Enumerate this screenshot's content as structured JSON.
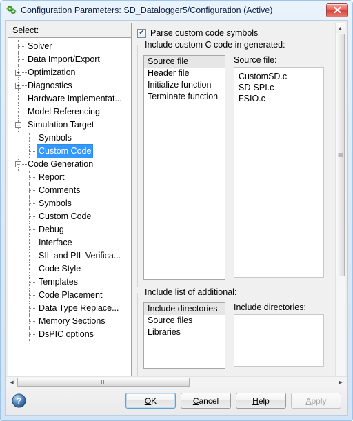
{
  "window": {
    "title": "Configuration Parameters: SD_Datalogger5/Configuration (Active)",
    "icon": "simulink-gear-icon",
    "close_label": "✕",
    "accent_blue": "#3399ff",
    "frame_color": "#9ec4e8",
    "close_color": "#d8423c"
  },
  "sidebar": {
    "header": "Select:",
    "items": [
      {
        "label": "Solver",
        "level": 0,
        "expander": "leaf",
        "selected": false
      },
      {
        "label": "Data Import/Export",
        "level": 0,
        "expander": "leaf",
        "selected": false
      },
      {
        "label": "Optimization",
        "level": 0,
        "expander": "collapsed",
        "selected": false
      },
      {
        "label": "Diagnostics",
        "level": 0,
        "expander": "collapsed",
        "selected": false
      },
      {
        "label": "Hardware Implementat...",
        "level": 0,
        "expander": "leaf",
        "selected": false
      },
      {
        "label": "Model Referencing",
        "level": 0,
        "expander": "leaf",
        "selected": false
      },
      {
        "label": "Simulation Target",
        "level": 0,
        "expander": "expanded",
        "selected": false
      },
      {
        "label": "Symbols",
        "level": 1,
        "expander": "leaf",
        "selected": false
      },
      {
        "label": "Custom Code",
        "level": 1,
        "expander": "leaf",
        "selected": true
      },
      {
        "label": "Code Generation",
        "level": 0,
        "expander": "expanded",
        "selected": false
      },
      {
        "label": "Report",
        "level": 1,
        "expander": "leaf",
        "selected": false
      },
      {
        "label": "Comments",
        "level": 1,
        "expander": "leaf",
        "selected": false
      },
      {
        "label": "Symbols",
        "level": 1,
        "expander": "leaf",
        "selected": false
      },
      {
        "label": "Custom Code",
        "level": 1,
        "expander": "leaf",
        "selected": false
      },
      {
        "label": "Debug",
        "level": 1,
        "expander": "leaf",
        "selected": false
      },
      {
        "label": "Interface",
        "level": 1,
        "expander": "leaf",
        "selected": false
      },
      {
        "label": "SIL and PIL Verifica...",
        "level": 1,
        "expander": "leaf",
        "selected": false
      },
      {
        "label": "Code Style",
        "level": 1,
        "expander": "leaf",
        "selected": false
      },
      {
        "label": "Templates",
        "level": 1,
        "expander": "leaf",
        "selected": false
      },
      {
        "label": "Code Placement",
        "level": 1,
        "expander": "leaf",
        "selected": false
      },
      {
        "label": "Data Type Replace...",
        "level": 1,
        "expander": "leaf",
        "selected": false
      },
      {
        "label": "Memory Sections",
        "level": 1,
        "expander": "leaf",
        "selected": false
      },
      {
        "label": "DsPIC options",
        "level": 1,
        "expander": "leaf",
        "selected": false
      }
    ]
  },
  "main": {
    "parse_checkbox": {
      "label": "Parse custom code symbols",
      "checked": true,
      "check_glyph": "✔"
    },
    "group_custom_code": {
      "title": "Include custom C code in generated:",
      "list": [
        {
          "label": "Source file",
          "selected": true
        },
        {
          "label": "Header file",
          "selected": false
        },
        {
          "label": "Initialize function",
          "selected": false
        },
        {
          "label": "Terminate function",
          "selected": false
        }
      ],
      "detail_label": "Source file:",
      "detail_lines": [
        "CustomSD.c",
        "SD-SPI.c",
        "FSIO.c"
      ]
    },
    "group_include_list": {
      "title": "Include list of additional:",
      "list": [
        {
          "label": "Include directories",
          "selected": true
        },
        {
          "label": "Source files",
          "selected": false
        },
        {
          "label": "Libraries",
          "selected": false
        }
      ],
      "detail_label": "Include directories:",
      "detail_lines": []
    }
  },
  "scrollbars": {
    "v_up": "▲",
    "v_down": "▼",
    "h_left": "◀",
    "h_right": "▶"
  },
  "footer": {
    "help_icon": "question-mark-icon",
    "buttons": [
      {
        "label_pre": "",
        "mnemonic": "O",
        "label_post": "K",
        "name": "ok-button",
        "state": "default"
      },
      {
        "label_pre": "",
        "mnemonic": "C",
        "label_post": "ancel",
        "name": "cancel-button",
        "state": "normal"
      },
      {
        "label_pre": "",
        "mnemonic": "H",
        "label_post": "elp",
        "name": "help-button",
        "state": "normal"
      },
      {
        "label_pre": "",
        "mnemonic": "A",
        "label_post": "pply",
        "name": "apply-button",
        "state": "disabled"
      }
    ]
  }
}
